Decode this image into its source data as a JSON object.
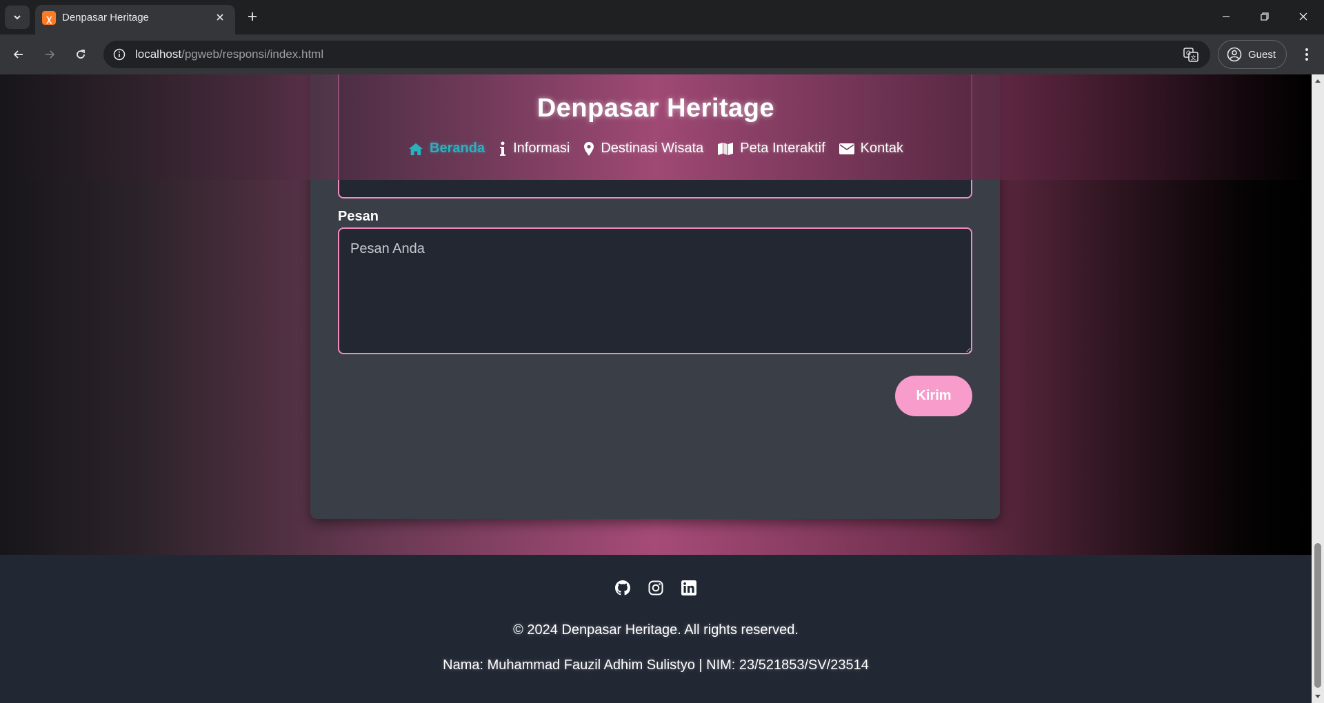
{
  "browser": {
    "tab": {
      "title": "Denpasar Heritage",
      "favicon": "xampp-icon"
    },
    "url": {
      "host": "localhost",
      "path": "/pgweb/responsi/index.html"
    },
    "profile_label": "Guest"
  },
  "header": {
    "title": "Denpasar Heritage",
    "nav": [
      {
        "label": "Beranda",
        "icon": "home-icon",
        "active": true
      },
      {
        "label": "Informasi",
        "icon": "info-icon",
        "active": false
      },
      {
        "label": "Destinasi Wisata",
        "icon": "map-marker-icon",
        "active": false
      },
      {
        "label": "Peta Interaktif",
        "icon": "map-icon",
        "active": false
      },
      {
        "label": "Kontak",
        "icon": "envelope-icon",
        "active": false
      }
    ],
    "active_color": "#2bb0bd"
  },
  "contact_form": {
    "message_label": "Pesan",
    "message_placeholder": "Pesan Anda",
    "message_value": "",
    "submit_label": "Kirim",
    "accent_color": "#f79ccb"
  },
  "footer": {
    "social": [
      "github-icon",
      "instagram-icon",
      "linkedin-icon"
    ],
    "copyright": "© 2024 Denpasar Heritage. All rights reserved.",
    "author": "Nama: Muhammad Fauzil Adhim Sulistyo | NIM: 23/521853/SV/23514"
  }
}
